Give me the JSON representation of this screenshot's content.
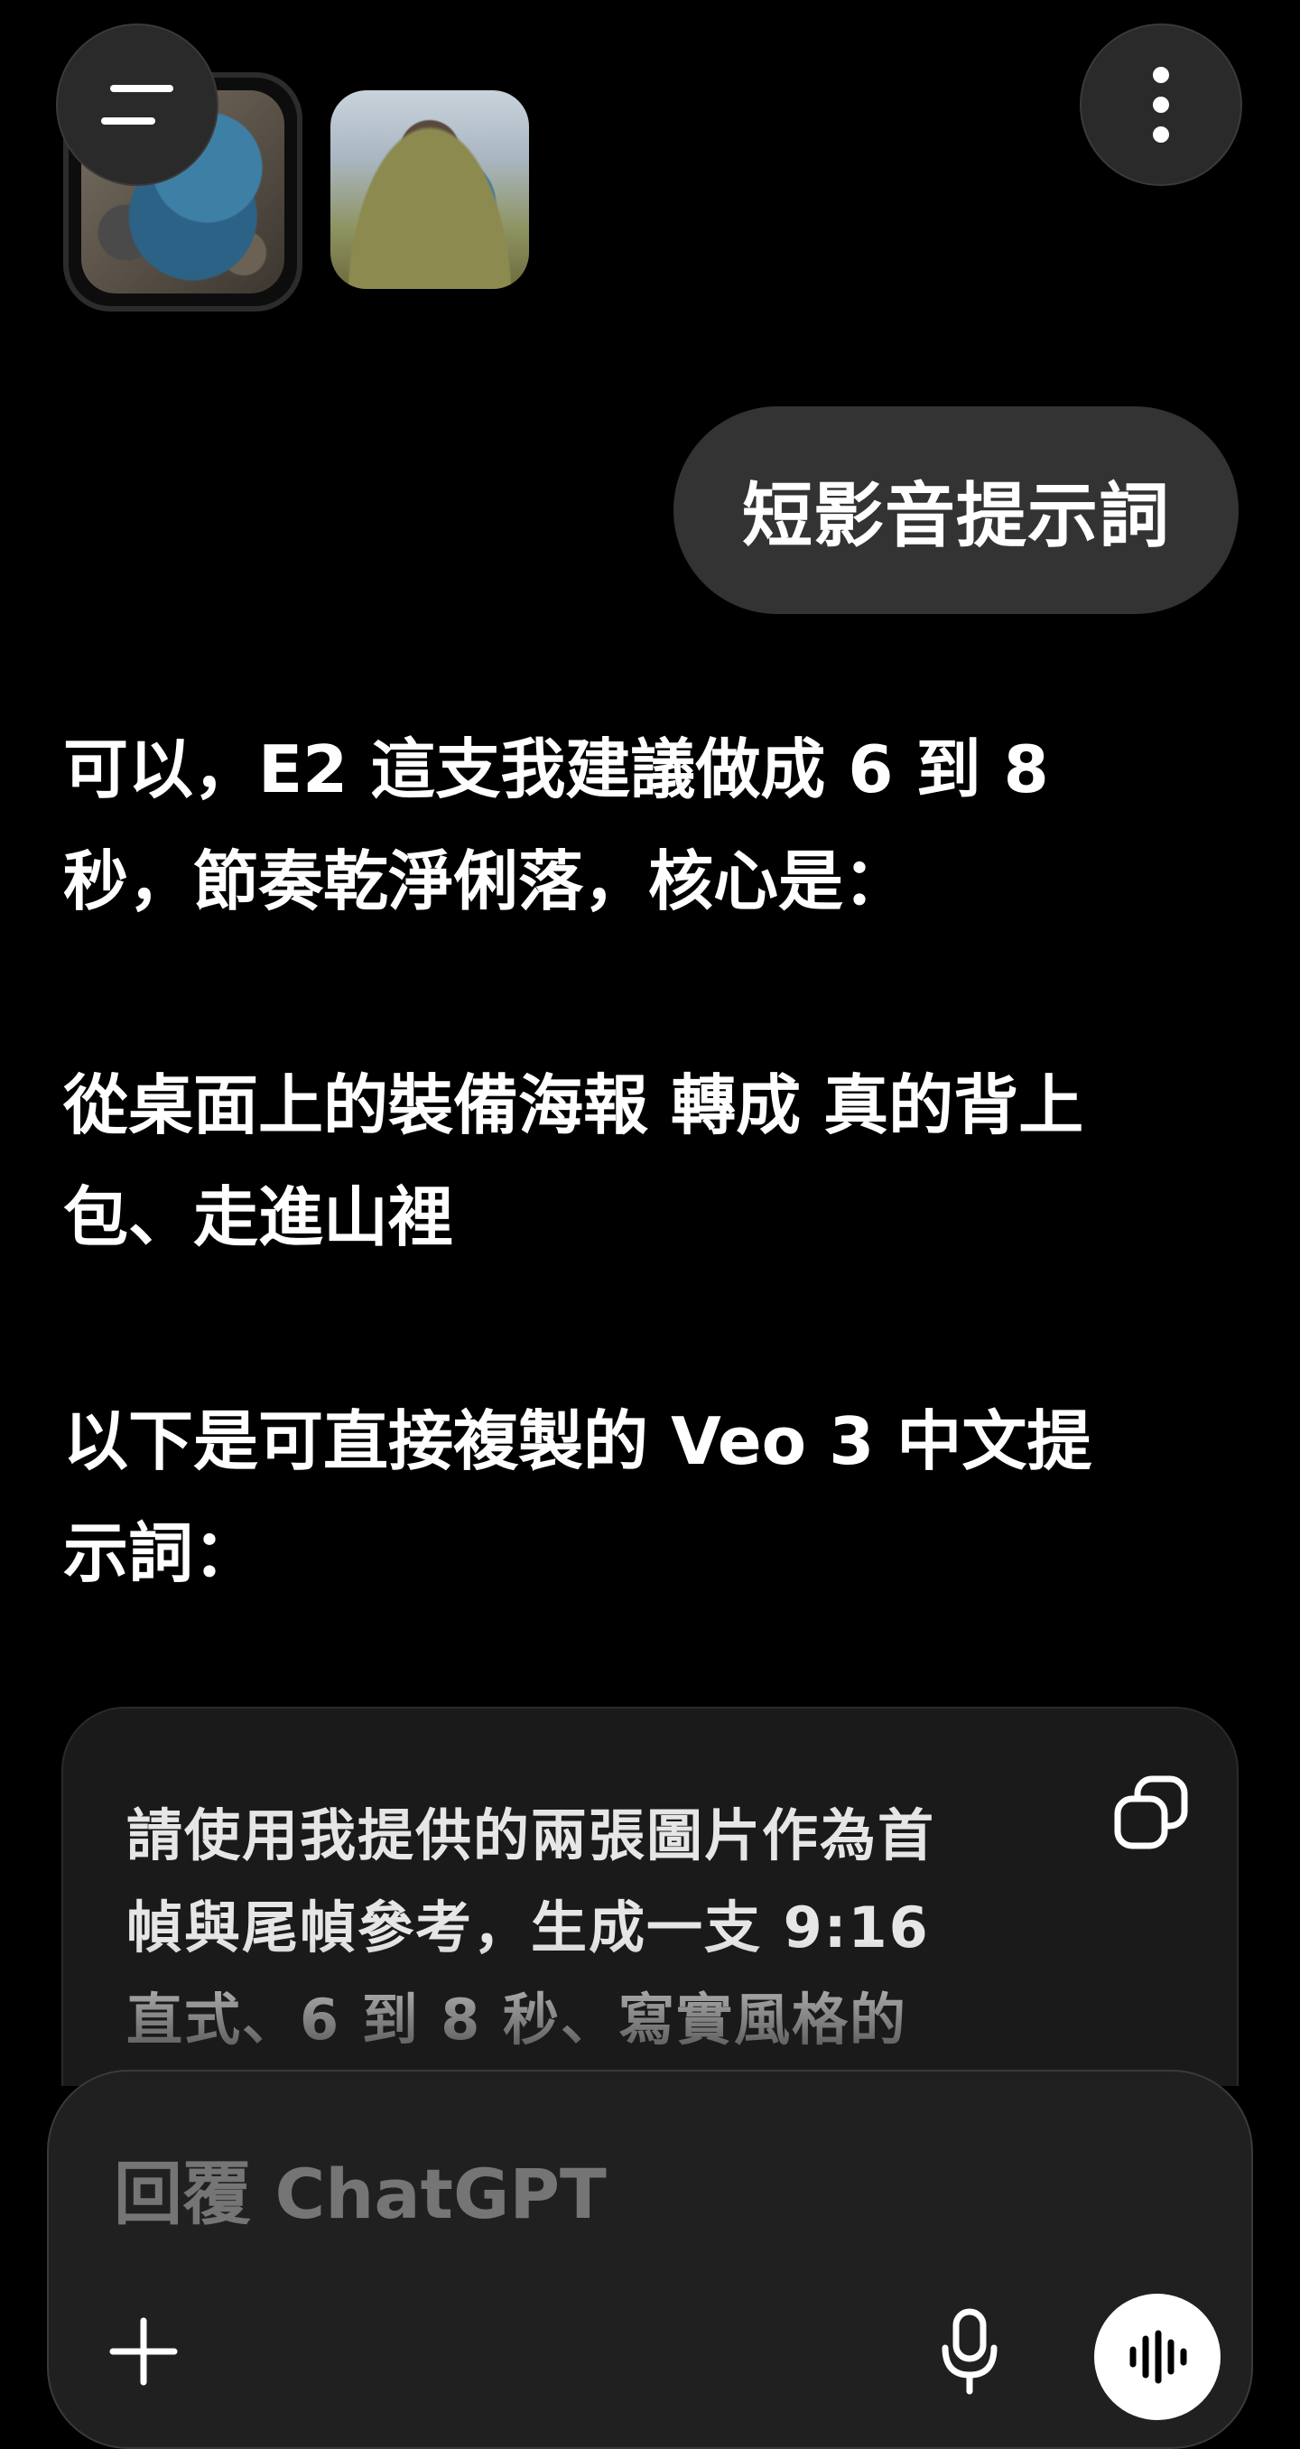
{
  "attachments": [
    {
      "name": "backpack-flatlay-image",
      "selected": true
    },
    {
      "name": "hiker-with-backpack-image",
      "selected": false
    }
  ],
  "user_message": "短影音提示詞",
  "assistant": {
    "paragraphs": [
      "可以，E2 這支我建議做成 6 到 8\n秒，節奏乾淨俐落，核心是：",
      "從桌面上的裝備海報 轉成 真的背上\n包、走進山裡",
      "以下是可直接複製的 Veo 3 中文提\n示詞："
    ]
  },
  "prompt_block": {
    "text": "請使用我提供的兩張圖片作為首\n幀與尾幀參考，生成一支 9:16\n直式、6 到 8 秒、寫實風格的"
  },
  "composer": {
    "placeholder": "回覆 ChatGPT"
  },
  "icons": {
    "menu": "menu-icon",
    "more": "more-vertical-icon",
    "copy": "copy-icon",
    "plus": "plus-icon",
    "mic": "microphone-icon",
    "voice": "voice-waveform-icon"
  },
  "colors": {
    "background": "#000000",
    "bubble": "#333333",
    "composer": "#202020",
    "placeholder": "#8d8d8d",
    "voice_button": "#ffffff"
  }
}
